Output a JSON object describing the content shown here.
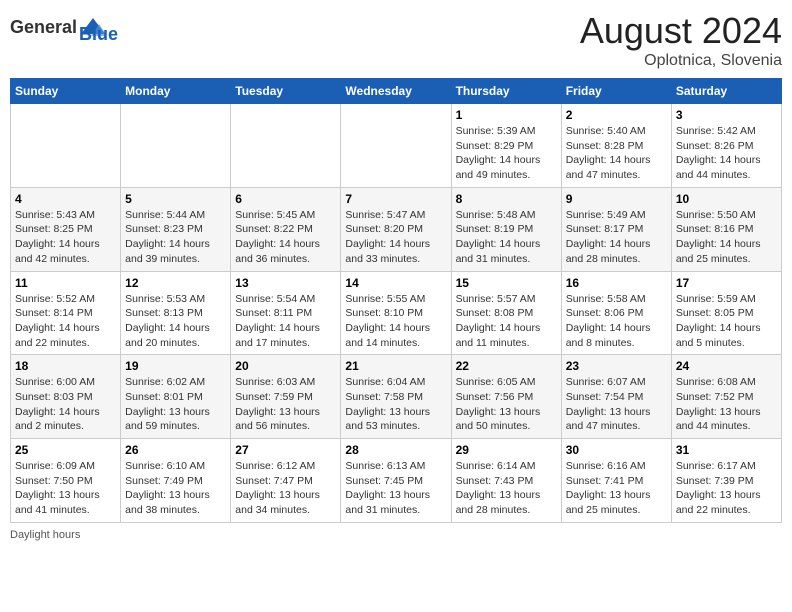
{
  "header": {
    "logo_general": "General",
    "logo_blue": "Blue",
    "title": "August 2024",
    "subtitle": "Oplotnica, Slovenia"
  },
  "weekdays": [
    "Sunday",
    "Monday",
    "Tuesday",
    "Wednesday",
    "Thursday",
    "Friday",
    "Saturday"
  ],
  "footer": {
    "daylight_label": "Daylight hours"
  },
  "weeks": [
    [
      {
        "day": "",
        "info": ""
      },
      {
        "day": "",
        "info": ""
      },
      {
        "day": "",
        "info": ""
      },
      {
        "day": "",
        "info": ""
      },
      {
        "day": "1",
        "info": "Sunrise: 5:39 AM\nSunset: 8:29 PM\nDaylight: 14 hours\nand 49 minutes."
      },
      {
        "day": "2",
        "info": "Sunrise: 5:40 AM\nSunset: 8:28 PM\nDaylight: 14 hours\nand 47 minutes."
      },
      {
        "day": "3",
        "info": "Sunrise: 5:42 AM\nSunset: 8:26 PM\nDaylight: 14 hours\nand 44 minutes."
      }
    ],
    [
      {
        "day": "4",
        "info": "Sunrise: 5:43 AM\nSunset: 8:25 PM\nDaylight: 14 hours\nand 42 minutes."
      },
      {
        "day": "5",
        "info": "Sunrise: 5:44 AM\nSunset: 8:23 PM\nDaylight: 14 hours\nand 39 minutes."
      },
      {
        "day": "6",
        "info": "Sunrise: 5:45 AM\nSunset: 8:22 PM\nDaylight: 14 hours\nand 36 minutes."
      },
      {
        "day": "7",
        "info": "Sunrise: 5:47 AM\nSunset: 8:20 PM\nDaylight: 14 hours\nand 33 minutes."
      },
      {
        "day": "8",
        "info": "Sunrise: 5:48 AM\nSunset: 8:19 PM\nDaylight: 14 hours\nand 31 minutes."
      },
      {
        "day": "9",
        "info": "Sunrise: 5:49 AM\nSunset: 8:17 PM\nDaylight: 14 hours\nand 28 minutes."
      },
      {
        "day": "10",
        "info": "Sunrise: 5:50 AM\nSunset: 8:16 PM\nDaylight: 14 hours\nand 25 minutes."
      }
    ],
    [
      {
        "day": "11",
        "info": "Sunrise: 5:52 AM\nSunset: 8:14 PM\nDaylight: 14 hours\nand 22 minutes."
      },
      {
        "day": "12",
        "info": "Sunrise: 5:53 AM\nSunset: 8:13 PM\nDaylight: 14 hours\nand 20 minutes."
      },
      {
        "day": "13",
        "info": "Sunrise: 5:54 AM\nSunset: 8:11 PM\nDaylight: 14 hours\nand 17 minutes."
      },
      {
        "day": "14",
        "info": "Sunrise: 5:55 AM\nSunset: 8:10 PM\nDaylight: 14 hours\nand 14 minutes."
      },
      {
        "day": "15",
        "info": "Sunrise: 5:57 AM\nSunset: 8:08 PM\nDaylight: 14 hours\nand 11 minutes."
      },
      {
        "day": "16",
        "info": "Sunrise: 5:58 AM\nSunset: 8:06 PM\nDaylight: 14 hours\nand 8 minutes."
      },
      {
        "day": "17",
        "info": "Sunrise: 5:59 AM\nSunset: 8:05 PM\nDaylight: 14 hours\nand 5 minutes."
      }
    ],
    [
      {
        "day": "18",
        "info": "Sunrise: 6:00 AM\nSunset: 8:03 PM\nDaylight: 14 hours\nand 2 minutes."
      },
      {
        "day": "19",
        "info": "Sunrise: 6:02 AM\nSunset: 8:01 PM\nDaylight: 13 hours\nand 59 minutes."
      },
      {
        "day": "20",
        "info": "Sunrise: 6:03 AM\nSunset: 7:59 PM\nDaylight: 13 hours\nand 56 minutes."
      },
      {
        "day": "21",
        "info": "Sunrise: 6:04 AM\nSunset: 7:58 PM\nDaylight: 13 hours\nand 53 minutes."
      },
      {
        "day": "22",
        "info": "Sunrise: 6:05 AM\nSunset: 7:56 PM\nDaylight: 13 hours\nand 50 minutes."
      },
      {
        "day": "23",
        "info": "Sunrise: 6:07 AM\nSunset: 7:54 PM\nDaylight: 13 hours\nand 47 minutes."
      },
      {
        "day": "24",
        "info": "Sunrise: 6:08 AM\nSunset: 7:52 PM\nDaylight: 13 hours\nand 44 minutes."
      }
    ],
    [
      {
        "day": "25",
        "info": "Sunrise: 6:09 AM\nSunset: 7:50 PM\nDaylight: 13 hours\nand 41 minutes."
      },
      {
        "day": "26",
        "info": "Sunrise: 6:10 AM\nSunset: 7:49 PM\nDaylight: 13 hours\nand 38 minutes."
      },
      {
        "day": "27",
        "info": "Sunrise: 6:12 AM\nSunset: 7:47 PM\nDaylight: 13 hours\nand 34 minutes."
      },
      {
        "day": "28",
        "info": "Sunrise: 6:13 AM\nSunset: 7:45 PM\nDaylight: 13 hours\nand 31 minutes."
      },
      {
        "day": "29",
        "info": "Sunrise: 6:14 AM\nSunset: 7:43 PM\nDaylight: 13 hours\nand 28 minutes."
      },
      {
        "day": "30",
        "info": "Sunrise: 6:16 AM\nSunset: 7:41 PM\nDaylight: 13 hours\nand 25 minutes."
      },
      {
        "day": "31",
        "info": "Sunrise: 6:17 AM\nSunset: 7:39 PM\nDaylight: 13 hours\nand 22 minutes."
      }
    ]
  ]
}
